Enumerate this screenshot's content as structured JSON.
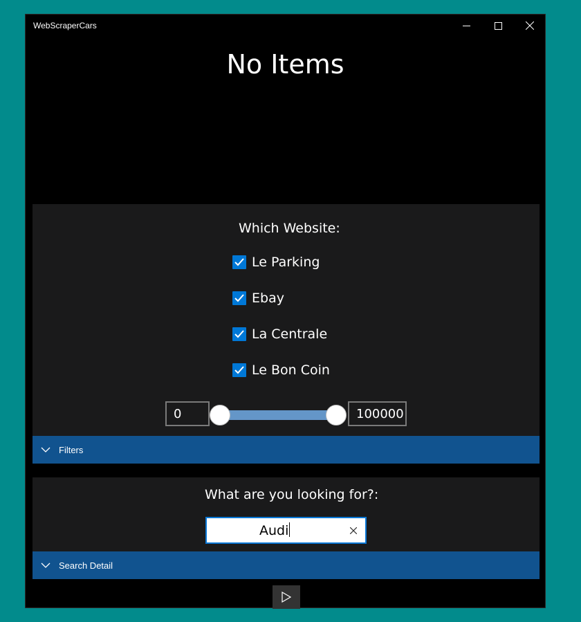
{
  "window": {
    "title": "WebScraperCars"
  },
  "main": {
    "heading": "No Items"
  },
  "filters": {
    "which_label": "Which Website:",
    "websites": [
      {
        "label": "Le Parking",
        "checked": true
      },
      {
        "label": "Ebay",
        "checked": true
      },
      {
        "label": "La Centrale",
        "checked": true
      },
      {
        "label": "Le Bon Coin",
        "checked": true
      }
    ],
    "range": {
      "min_value": "0",
      "max_value": "100000"
    },
    "expander_label": "Filters"
  },
  "search": {
    "prompt": "What are you looking for?:",
    "value": "Audi",
    "expander_label": "Search Detail"
  },
  "colors": {
    "accent": "#0078d7",
    "expander": "#11538f",
    "slider": "#6496c8",
    "desktop": "#028b8c"
  },
  "icons": {
    "minimize": "minimize-icon",
    "maximize": "maximize-icon",
    "close": "close-icon",
    "chevron": "chevron-down-icon",
    "clear": "clear-icon",
    "play": "play-icon",
    "check": "checkmark-icon"
  }
}
